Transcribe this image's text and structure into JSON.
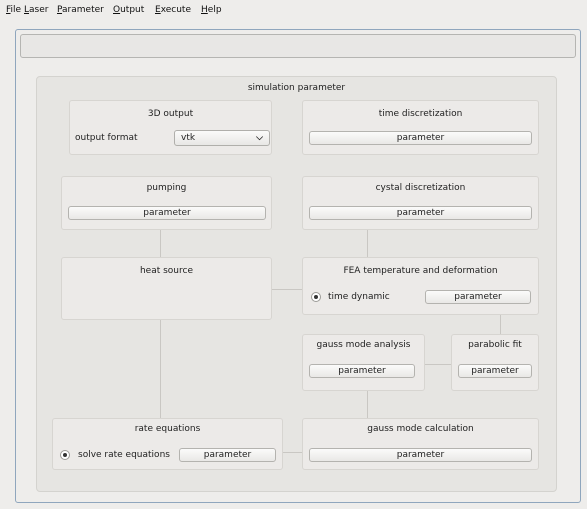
{
  "menu": [
    {
      "mnemonic": "F",
      "rest": "ile"
    },
    {
      "mnemonic": "L",
      "rest": "aser"
    },
    {
      "mnemonic": "P",
      "rest": "arameter"
    },
    {
      "mnemonic": "O",
      "rest": "utput"
    },
    {
      "mnemonic": "E",
      "rest": "xecute"
    },
    {
      "mnemonic": "H",
      "rest": "elp"
    }
  ],
  "panel": {
    "title": "simulation parameter"
  },
  "output3d": {
    "title": "3D output",
    "format_label": "output format",
    "format_value": "vtk"
  },
  "time_disc": {
    "title": "time discretization",
    "button": "parameter"
  },
  "pumping": {
    "title": "pumping",
    "button": "parameter"
  },
  "crystal_disc": {
    "title": "cystal discretization",
    "button": "parameter"
  },
  "heat_source": {
    "title": "heat source"
  },
  "fea": {
    "title": "FEA temperature and deformation",
    "radio_label": "time dynamic",
    "button": "parameter"
  },
  "gauss_analysis": {
    "title": "gauss mode analysis",
    "button": "parameter"
  },
  "parabolic_fit": {
    "title": "parabolic fit",
    "button": "parameter"
  },
  "rate_eq": {
    "title": "rate equations",
    "radio_label": "solve rate equations",
    "button": "parameter"
  },
  "gauss_calc": {
    "title": "gauss mode calculation",
    "button": "parameter"
  }
}
